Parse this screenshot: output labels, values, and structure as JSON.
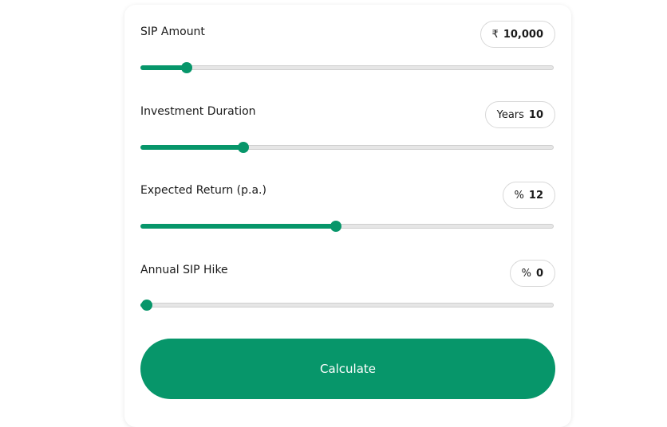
{
  "colors": {
    "accent": "#07966a",
    "track": "#e6e6e6",
    "text": "#1a1a1a"
  },
  "sliders": [
    {
      "label": "SIP Amount",
      "prefix": "₹",
      "value": "10,000",
      "fraction": 0.1
    },
    {
      "label": "Investment Duration",
      "prefix": "Years",
      "value": "10",
      "fraction": 0.24
    },
    {
      "label": "Expected Return (p.a.)",
      "prefix": "%",
      "value": "12",
      "fraction": 0.47
    },
    {
      "label": "Annual SIP Hike",
      "prefix": "%",
      "value": "0",
      "fraction": 0.0
    }
  ],
  "calculate_button": {
    "label": "Calculate"
  }
}
